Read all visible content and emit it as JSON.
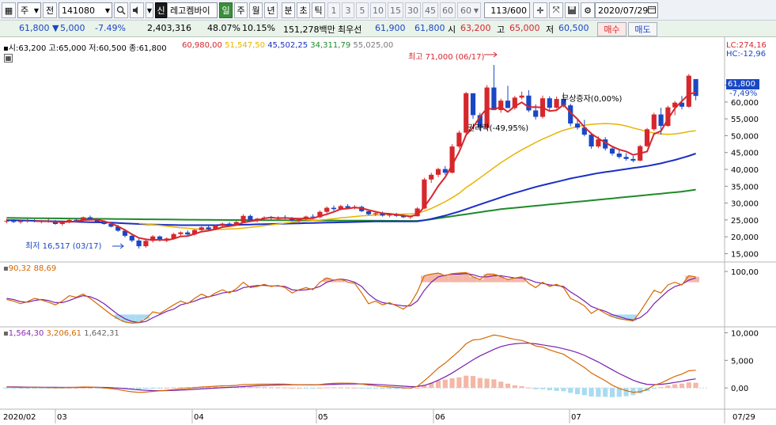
{
  "toolbar": {
    "period_value": "주",
    "prev_label": "전",
    "code": "141080",
    "badge": "신",
    "stock_name": "레고켐바이",
    "periods": [
      "일",
      "주",
      "월",
      "년",
      "분",
      "초",
      "틱"
    ],
    "minute_steps": [
      "1",
      "3",
      "5",
      "10",
      "15",
      "30",
      "45",
      "60",
      "60"
    ],
    "count": "113",
    "count_total": "/600",
    "date": "2020/07/29"
  },
  "quote": {
    "price": "61,800",
    "change": "5,000",
    "rate": "-7.49%",
    "volume": "2,403,316",
    "vol_ratio": "48.07%",
    "turnover": "10.15%",
    "amount": "151,278백만",
    "best_label": "최우선",
    "best_ask": "61,900",
    "best_bid": "61,800",
    "open_label": "시",
    "open": "63,200",
    "high_label": "고",
    "high": "65,000",
    "low_label": "저",
    "low": "60,500",
    "buy_label": "매수",
    "sell_label": "매도"
  },
  "price_panel": {
    "ohlc": "시:63,200 고:65,000 저:60,500 종:61,800",
    "ma_values": [
      {
        "text": "60,980,00",
        "color": "#d6272d"
      },
      {
        "text": "51,547,50",
        "color": "#e8b400"
      },
      {
        "text": "45,502,25",
        "color": "#1a2fc4"
      },
      {
        "text": "34,311,79",
        "color": "#1f8a2a"
      },
      {
        "text": "55,025,00",
        "color": "#7a7a7a"
      }
    ],
    "lc": "LC:274,16",
    "hc": "HC:-12,96",
    "last_price": "61,800",
    "last_rate": "-7,49%",
    "high_note": "최고 71,000 (06/17)",
    "low_note": "최저 16,517 (03/17)",
    "event_rights": "권리락(-49,95%)",
    "event_bonus": "무상증자(0,00%)",
    "y_ticks": [
      "65,000",
      "60,000",
      "55,000",
      "50,000",
      "45,000",
      "40,000",
      "35,000",
      "30,000",
      "25,000",
      "20,000",
      "15,000"
    ]
  },
  "stoch_panel": {
    "values": "90,32 88,69",
    "y_ticks": [
      "100,00"
    ]
  },
  "macd_panel": {
    "v1": "1,564,30",
    "v2": "3,206,61",
    "v3": "1,642,31",
    "y_ticks": [
      "10,000",
      "5,000",
      "0,00"
    ]
  },
  "x_axis": {
    "labels": [
      "2020/02",
      "03",
      "04",
      "05",
      "06",
      "07",
      "07/29"
    ]
  },
  "colors": {
    "up": "#d6272d",
    "down": "#1a47c4",
    "ma5": "#d6272d",
    "ma20": "#e8b400",
    "ma60": "#1a2fc4",
    "ma120": "#1f8a2a",
    "ma10": "#7a7a7a"
  },
  "chart_data": {
    "type": "candlestick",
    "ylim": [
      13000,
      75000
    ],
    "candles": [
      [
        24600,
        25300,
        24000,
        24700
      ],
      [
        24700,
        25200,
        24100,
        24400
      ],
      [
        24400,
        25000,
        23900,
        24600
      ],
      [
        24600,
        25300,
        24200,
        24800
      ],
      [
        24800,
        25200,
        24300,
        24500
      ],
      [
        24500,
        25000,
        24000,
        24700
      ],
      [
        24700,
        25300,
        24200,
        24400
      ],
      [
        24400,
        25000,
        23600,
        23800
      ],
      [
        23800,
        24500,
        23300,
        24300
      ],
      [
        24300,
        25200,
        24000,
        25000
      ],
      [
        25000,
        25500,
        24400,
        24800
      ],
      [
        24800,
        26000,
        24600,
        25800
      ],
      [
        25800,
        26300,
        25000,
        25200
      ],
      [
        25200,
        25600,
        24300,
        24500
      ],
      [
        24500,
        24900,
        23600,
        23800
      ],
      [
        23800,
        24200,
        22800,
        23000
      ],
      [
        23000,
        23500,
        21500,
        21800
      ],
      [
        21800,
        22300,
        19800,
        20300
      ],
      [
        20300,
        20800,
        18400,
        18900
      ],
      [
        18900,
        19400,
        16500,
        17200
      ],
      [
        17200,
        19200,
        16800,
        18800
      ],
      [
        18800,
        20500,
        18300,
        20100
      ],
      [
        20100,
        20400,
        18600,
        18900
      ],
      [
        18900,
        19800,
        18400,
        19500
      ],
      [
        19500,
        21200,
        19200,
        20800
      ],
      [
        20800,
        21600,
        20200,
        21300
      ],
      [
        21300,
        21900,
        20400,
        20700
      ],
      [
        20700,
        22300,
        20400,
        22000
      ],
      [
        22000,
        23100,
        21700,
        22800
      ],
      [
        22800,
        23300,
        21900,
        22200
      ],
      [
        22200,
        23700,
        22000,
        23400
      ],
      [
        23400,
        24200,
        22800,
        23900
      ],
      [
        23900,
        24400,
        23100,
        23600
      ],
      [
        23600,
        24700,
        23300,
        24400
      ],
      [
        24400,
        26700,
        24100,
        26200
      ],
      [
        26200,
        26600,
        24400,
        24900
      ],
      [
        24900,
        25600,
        24300,
        25400
      ],
      [
        25400,
        26100,
        24900,
        25700
      ],
      [
        25700,
        26200,
        25100,
        25500
      ],
      [
        25500,
        26100,
        25000,
        25800
      ],
      [
        25800,
        26400,
        25200,
        25600
      ],
      [
        25600,
        25900,
        24600,
        24800
      ],
      [
        24800,
        25500,
        24300,
        25300
      ],
      [
        25300,
        26300,
        24900,
        26000
      ],
      [
        26000,
        26700,
        25500,
        25800
      ],
      [
        25800,
        27800,
        25500,
        27400
      ],
      [
        27400,
        29000,
        27000,
        28600
      ],
      [
        28600,
        29300,
        27700,
        28200
      ],
      [
        28200,
        29500,
        27900,
        29100
      ],
      [
        29100,
        29700,
        28300,
        28600
      ],
      [
        28600,
        29400,
        28100,
        28900
      ],
      [
        28900,
        29200,
        27300,
        27600
      ],
      [
        27600,
        28000,
        26400,
        26700
      ],
      [
        26700,
        27400,
        26200,
        27000
      ],
      [
        27000,
        27500,
        26000,
        26300
      ],
      [
        26300,
        26900,
        25800,
        26600
      ],
      [
        26600,
        27100,
        25900,
        26200
      ],
      [
        26200,
        26700,
        25600,
        25800
      ],
      [
        25800,
        26300,
        25300,
        26100
      ],
      [
        26100,
        28800,
        26000,
        28400
      ],
      [
        28400,
        37500,
        28200,
        37000
      ],
      [
        37000,
        39000,
        36000,
        38400
      ],
      [
        38400,
        40500,
        37700,
        40100
      ],
      [
        40100,
        41000,
        38400,
        39000
      ],
      [
        39000,
        47500,
        38800,
        46800
      ],
      [
        46800,
        51500,
        46300,
        50900
      ],
      [
        50900,
        63000,
        50500,
        62600
      ],
      [
        62600,
        61500,
        55000,
        56100
      ],
      [
        56100,
        56800,
        51500,
        52300
      ],
      [
        52300,
        65000,
        51800,
        64300
      ],
      [
        64300,
        71000,
        63800,
        57600
      ],
      [
        57600,
        61000,
        56800,
        60400
      ],
      [
        60400,
        64800,
        59900,
        58200
      ],
      [
        58200,
        61800,
        57700,
        61300
      ],
      [
        61300,
        63100,
        60800,
        61900
      ],
      [
        61900,
        63500,
        57000,
        57500
      ],
      [
        57500,
        59300,
        54800,
        55600
      ],
      [
        55600,
        61900,
        55100,
        61100
      ],
      [
        61100,
        61700,
        57500,
        58300
      ],
      [
        58300,
        61600,
        58000,
        60900
      ],
      [
        60900,
        62800,
        58400,
        59000
      ],
      [
        59000,
        59500,
        52800,
        53600
      ],
      [
        53600,
        55000,
        51800,
        52400
      ],
      [
        52400,
        54700,
        49800,
        50300
      ],
      [
        50300,
        50900,
        46100,
        46800
      ],
      [
        46800,
        49800,
        46300,
        48900
      ],
      [
        48900,
        49600,
        45600,
        46200
      ],
      [
        46200,
        47000,
        44100,
        44700
      ],
      [
        44700,
        45900,
        43200,
        43700
      ],
      [
        43700,
        44800,
        42600,
        43100
      ],
      [
        43100,
        44000,
        42100,
        42600
      ],
      [
        42600,
        47300,
        42400,
        46900
      ],
      [
        46900,
        52300,
        46600,
        51900
      ],
      [
        51900,
        56800,
        51400,
        56300
      ],
      [
        56300,
        58300,
        50300,
        52900
      ],
      [
        52900,
        58900,
        52600,
        58400
      ],
      [
        58400,
        60300,
        56100,
        59800
      ],
      [
        59800,
        61800,
        57800,
        58600
      ],
      [
        58600,
        68300,
        58300,
        67800
      ],
      [
        66800,
        65000,
        60500,
        61800
      ]
    ],
    "ma5": [
      null,
      null,
      null,
      null,
      24640,
      24600,
      24600,
      24440,
      24400,
      24440,
      24540,
      24980,
      25020,
      25100,
      24600,
      24000,
      23100,
      22020,
      20760,
      19660,
      19240,
      19060,
      19120,
      18980,
      19420,
      20120,
      20240,
      20860,
      21520,
      21800,
      22240,
      22860,
      23140,
      23480,
      24260,
      24600,
      24880,
      25480,
      25740,
      25480,
      25600,
      25480,
      25400,
      25440,
      25500,
      26100,
      26700,
      27400,
      28220,
      28380,
      28680,
      28500,
      27940,
      27440,
      26980,
      26840,
      26540,
      26300,
      26060,
      26580,
      28880,
      31820,
      35060,
      37680,
      41300,
      45180,
      50200,
      52460,
      55600,
      58140,
      57820,
      58540,
      57060,
      58740,
      59900,
      58460,
      58500,
      58340,
      57300,
      57560,
      59200,
      56900,
      54920,
      52560,
      50600,
      49200,
      48000,
      46760,
      45900,
      45320,
      44300,
      44780,
      45280,
      50500,
      51380,
      54920,
      58140,
      60240,
      62300,
      62880
    ],
    "ma20": [
      null,
      null,
      null,
      null,
      null,
      null,
      null,
      null,
      null,
      null,
      null,
      null,
      null,
      null,
      null,
      null,
      null,
      null,
      null,
      24000,
      23800,
      23600,
      23400,
      23150,
      22900,
      22700,
      22550,
      22350,
      22250,
      22200,
      22150,
      22200,
      22300,
      22400,
      22550,
      22800,
      23050,
      23300,
      23550,
      23800,
      24050,
      24300,
      24500,
      24650,
      24800,
      24950,
      25150,
      25350,
      25600,
      25800,
      26000,
      26200,
      26350,
      26450,
      26550,
      26650,
      26700,
      26750,
      26800,
      27000,
      27600,
      28400,
      29400,
      30400,
      31600,
      32900,
      34600,
      36000,
      37500,
      39000,
      40500,
      42000,
      43300,
      44600,
      45800,
      46900,
      48000,
      49000,
      49900,
      50800,
      51600,
      52200,
      52700,
      53100,
      53400,
      53500,
      53600,
      53500,
      53300,
      52900,
      52300,
      51800,
      51200,
      50800,
      50500,
      50400,
      50500,
      50800,
      51200,
      51500
    ],
    "ma60": [
      24900,
      24900,
      24850,
      24800,
      24750,
      24700,
      24650,
      24600,
      24550,
      24500,
      24450,
      24400,
      24350,
      24300,
      24250,
      24200,
      24100,
      24000,
      23900,
      23800,
      23700,
      23650,
      23600,
      23550,
      23500,
      23450,
      23450,
      23450,
      23450,
      23450,
      23450,
      23500,
      23500,
      23550,
      23600,
      23650,
      23700,
      23750,
      23800,
      23850,
      23900,
      23950,
      24000,
      24050,
      24100,
      24150,
      24200,
      24250,
      24300,
      24350,
      24400,
      24450,
      24500,
      24550,
      24550,
      24550,
      24550,
      24550,
      24550,
      24600,
      24900,
      25300,
      25800,
      26300,
      26900,
      27500,
      28200,
      28900,
      29600,
      30300,
      31000,
      31700,
      32400,
      33000,
      33600,
      34200,
      34800,
      35300,
      35800,
      36300,
      36800,
      37300,
      37700,
      38100,
      38500,
      38900,
      39200,
      39500,
      39800,
      40100,
      40400,
      40700,
      41000,
      41400,
      41800,
      42300,
      42800,
      43400,
      44000,
      44700
    ],
    "ma120": [
      25600,
      25580,
      25560,
      25540,
      25520,
      25500,
      25480,
      25460,
      25440,
      25420,
      25400,
      25380,
      25360,
      25340,
      25320,
      25300,
      25280,
      25260,
      25240,
      25220,
      25200,
      25180,
      25160,
      25140,
      25120,
      25100,
      25080,
      25060,
      25040,
      25020,
      25000,
      24990,
      24980,
      24970,
      24960,
      24950,
      24940,
      24930,
      24920,
      24910,
      24900,
      24890,
      24880,
      24870,
      24860,
      24850,
      24840,
      24830,
      24820,
      24810,
      24800,
      24790,
      24780,
      24770,
      24760,
      24750,
      24740,
      24730,
      24720,
      24720,
      24900,
      25200,
      25500,
      25800,
      26100,
      26400,
      26700,
      27000,
      27300,
      27600,
      27900,
      28200,
      28400,
      28600,
      28800,
      29000,
      29200,
      29400,
      29600,
      29800,
      30000,
      30200,
      30400,
      30600,
      30800,
      31000,
      31200,
      31400,
      31600,
      31800,
      32000,
      32200,
      32400,
      32600,
      32800,
      33000,
      33200,
      33400,
      33700,
      34000
    ],
    "stoch_k": [
      48,
      45,
      40,
      44,
      50,
      47,
      43,
      38,
      45,
      55,
      52,
      58,
      50,
      40,
      30,
      20,
      12,
      6,
      4,
      5,
      12,
      25,
      22,
      30,
      38,
      45,
      40,
      50,
      58,
      52,
      60,
      66,
      60,
      68,
      80,
      70,
      72,
      76,
      72,
      74,
      70,
      60,
      66,
      70,
      66,
      80,
      88,
      84,
      86,
      80,
      78,
      60,
      40,
      45,
      38,
      42,
      36,
      30,
      40,
      62,
      92,
      95,
      97,
      92,
      96,
      97,
      98,
      90,
      85,
      95,
      95,
      90,
      85,
      88,
      90,
      78,
      70,
      80,
      72,
      76,
      70,
      50,
      44,
      36,
      22,
      30,
      22,
      16,
      12,
      10,
      8,
      25,
      45,
      65,
      60,
      75,
      80,
      75,
      92,
      90
    ],
    "stoch_d": [
      50,
      48,
      44,
      43,
      46,
      48,
      46,
      42,
      42,
      46,
      51,
      55,
      53,
      48,
      40,
      30,
      20,
      12,
      7,
      5,
      7,
      14,
      20,
      26,
      30,
      38,
      41,
      45,
      50,
      53,
      56,
      60,
      62,
      64,
      70,
      72,
      74,
      74,
      73,
      73,
      72,
      66,
      65,
      66,
      68,
      72,
      80,
      84,
      86,
      84,
      80,
      72,
      58,
      48,
      42,
      40,
      38,
      36,
      36,
      45,
      65,
      80,
      90,
      93,
      95,
      95,
      96,
      94,
      90,
      90,
      92,
      92,
      90,
      88,
      88,
      85,
      80,
      78,
      75,
      74,
      72,
      62,
      54,
      45,
      35,
      30,
      26,
      20,
      16,
      12,
      10,
      14,
      24,
      40,
      52,
      64,
      72,
      76,
      84,
      88
    ],
    "macd": [
      150,
      120,
      90,
      80,
      100,
      90,
      70,
      40,
      50,
      90,
      110,
      160,
      150,
      90,
      0,
      -120,
      -300,
      -520,
      -700,
      -820,
      -760,
      -620,
      -520,
      -420,
      -300,
      -160,
      -80,
      40,
      160,
      220,
      300,
      380,
      400,
      460,
      620,
      640,
      660,
      700,
      700,
      710,
      690,
      620,
      580,
      560,
      540,
      620,
      760,
      820,
      860,
      850,
      820,
      700,
      520,
      400,
      260,
      180,
      90,
      20,
      -20,
      280,
      1300,
      2400,
      3600,
      4500,
      5600,
      6700,
      8000,
      8700,
      8800,
      9200,
      9600,
      9400,
      9100,
      8800,
      8600,
      8200,
      7600,
      7400,
      6900,
      6500,
      6100,
      5300,
      4500,
      3700,
      2700,
      2000,
      1300,
      500,
      -100,
      -500,
      -800,
      -700,
      -300,
      500,
      900,
      1500,
      2100,
      2500,
      3100,
      3200
    ],
    "macd_signal": [
      200,
      180,
      160,
      140,
      130,
      120,
      110,
      100,
      90,
      90,
      95,
      110,
      120,
      110,
      90,
      50,
      -20,
      -120,
      -240,
      -360,
      -440,
      -480,
      -490,
      -480,
      -450,
      -400,
      -340,
      -260,
      -180,
      -110,
      -40,
      30,
      100,
      160,
      250,
      320,
      390,
      450,
      500,
      540,
      570,
      580,
      580,
      575,
      570,
      575,
      610,
      650,
      690,
      720,
      740,
      730,
      690,
      630,
      560,
      480,
      400,
      320,
      240,
      250,
      460,
      850,
      1400,
      2000,
      2700,
      3500,
      4300,
      5100,
      5800,
      6400,
      7000,
      7500,
      7800,
      8000,
      8100,
      8100,
      8000,
      7800,
      7600,
      7400,
      7100,
      6800,
      6400,
      5900,
      5300,
      4700,
      4000,
      3300,
      2600,
      2000,
      1400,
      950,
      650,
      600,
      650,
      800,
      1000,
      1200,
      1450,
      1640
    ]
  }
}
